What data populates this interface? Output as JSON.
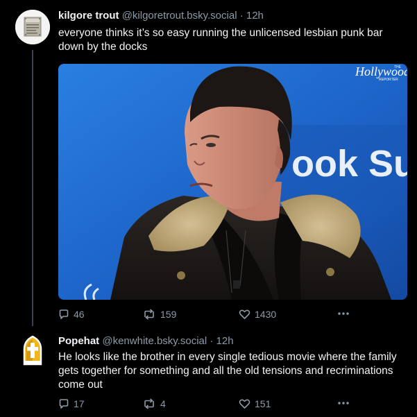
{
  "posts": [
    {
      "display_name": "kilgore trout",
      "handle": "@kilgoretrout.bsky.social",
      "separator": "·",
      "time": "12h",
      "text": "everyone thinks it’s so easy running the unlicensed lesbian punk bar down by the docks",
      "avatar_icon": "rusty-sign-avatar",
      "image": {
        "watermark_small": "THE",
        "watermark_main": "Hollywood",
        "watermark_sub": "REPORTER",
        "backdrop_text": "ook Sum"
      },
      "counts": {
        "replies": "46",
        "reposts": "159",
        "likes": "1430"
      }
    },
    {
      "display_name": "Popehat",
      "handle": "@kenwhite.bsky.social",
      "separator": "·",
      "time": "12h",
      "text": "He looks like the brother in every single tedious movie where the family gets together for something and all the old tensions and recriminations come out",
      "avatar_icon": "popehat-mitre-avatar",
      "counts": {
        "replies": "17",
        "reposts": "4",
        "likes": "151"
      }
    }
  ],
  "icons": {
    "reply": "speech-bubble-icon",
    "repost": "repost-arrows-icon",
    "like": "heart-icon",
    "more": "ellipsis-icon"
  },
  "colors": {
    "background": "#000000",
    "text": "#f1f3f5",
    "muted": "#8c9aa8",
    "thread_line": "#3b4350",
    "photo_backdrop": "#1f63c6",
    "popehat_gold": "#f2b51b"
  }
}
